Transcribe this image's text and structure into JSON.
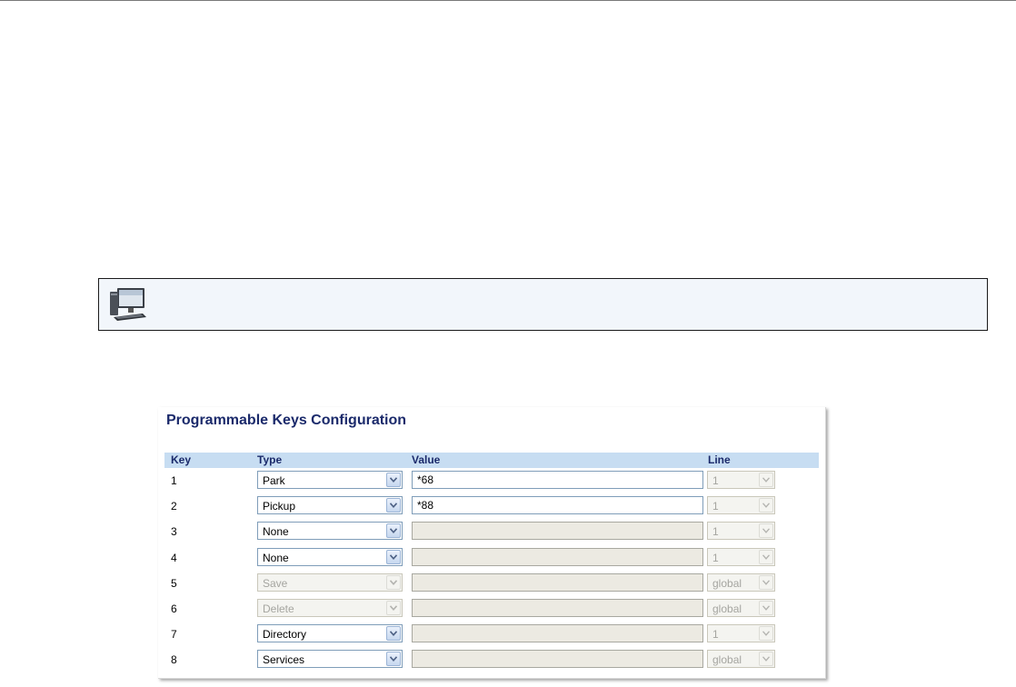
{
  "panel": {
    "title": "Programmable Keys Configuration",
    "columns": {
      "key": "Key",
      "type": "Type",
      "value": "Value",
      "line": "Line"
    },
    "rows": [
      {
        "key": "1",
        "type": "Park",
        "type_enabled": true,
        "value": "*68",
        "value_enabled": true,
        "line": "1",
        "line_enabled": false
      },
      {
        "key": "2",
        "type": "Pickup",
        "type_enabled": true,
        "value": "*88",
        "value_enabled": true,
        "line": "1",
        "line_enabled": false
      },
      {
        "key": "3",
        "type": "None",
        "type_enabled": true,
        "value": "",
        "value_enabled": false,
        "line": "1",
        "line_enabled": false
      },
      {
        "key": "4",
        "type": "None",
        "type_enabled": true,
        "value": "",
        "value_enabled": false,
        "line": "1",
        "line_enabled": false
      },
      {
        "key": "5",
        "type": "Save",
        "type_enabled": false,
        "value": "",
        "value_enabled": false,
        "line": "global",
        "line_enabled": false
      },
      {
        "key": "6",
        "type": "Delete",
        "type_enabled": false,
        "value": "",
        "value_enabled": false,
        "line": "global",
        "line_enabled": false
      },
      {
        "key": "7",
        "type": "Directory",
        "type_enabled": true,
        "value": "",
        "value_enabled": false,
        "line": "1",
        "line_enabled": false
      },
      {
        "key": "8",
        "type": "Services",
        "type_enabled": true,
        "value": "",
        "value_enabled": false,
        "line": "global",
        "line_enabled": false
      }
    ]
  },
  "note": {
    "icon": "computer-icon"
  },
  "colors": {
    "title": "#1b2a6b",
    "header_bg": "#c7ddf2",
    "note_bg": "#f2f6fb"
  }
}
